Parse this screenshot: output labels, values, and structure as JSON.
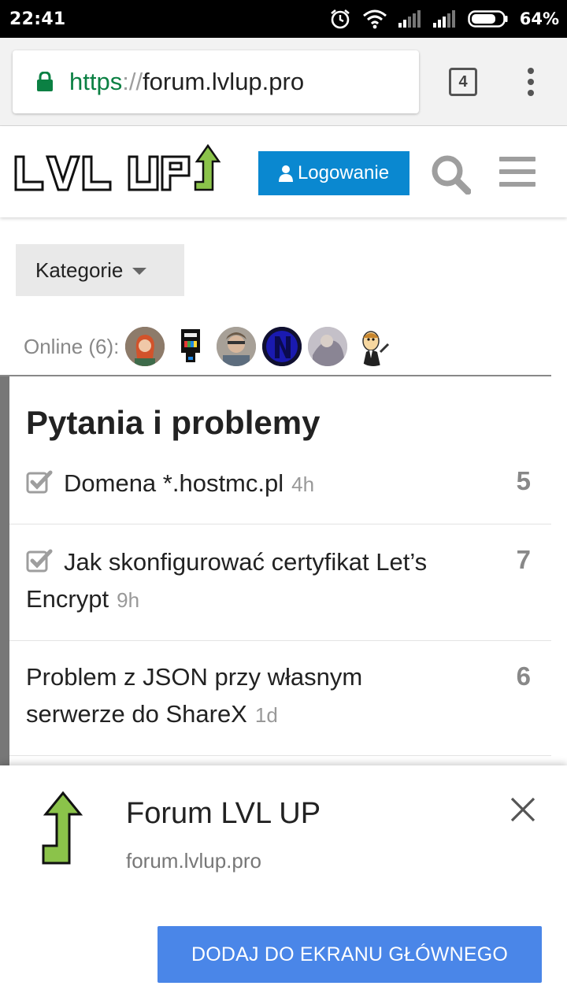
{
  "status_bar": {
    "time": "22:41",
    "battery": "64%"
  },
  "browser": {
    "url_scheme": "https",
    "url_sep": "://",
    "url_host": "forum.lvlup.pro",
    "tab_count": "4"
  },
  "site_header": {
    "logo_text": "LVL UP",
    "login_label": "Logowanie"
  },
  "categories_button": "Kategorie",
  "online": {
    "label": "Online (6):",
    "avatars": [
      "avatar-1",
      "avatar-2",
      "avatar-3",
      "avatar-4",
      "avatar-5",
      "avatar-6"
    ]
  },
  "category": {
    "title": "Pytania i problemy",
    "topics": [
      {
        "title": "Domena *.hostmc.pl",
        "age": "4h",
        "count": "5",
        "solved": true
      },
      {
        "title": "Jak skonfigurować certyfikat Let’s Encrypt",
        "age": "9h",
        "count": "7",
        "solved": true
      },
      {
        "title": "Problem z JSON przy własnym serwerze do ShareX",
        "age": "1d",
        "count": "6",
        "solved": false
      }
    ]
  },
  "banner": {
    "title": "Forum LVL UP",
    "url": "forum.lvlup.pro",
    "button": "DODAJ DO EKRANU GŁÓWNEGO"
  },
  "colors": {
    "accent_blue": "#0a88d0",
    "banner_button": "#4a86e8",
    "logo_arrow": "#8bc34a"
  }
}
